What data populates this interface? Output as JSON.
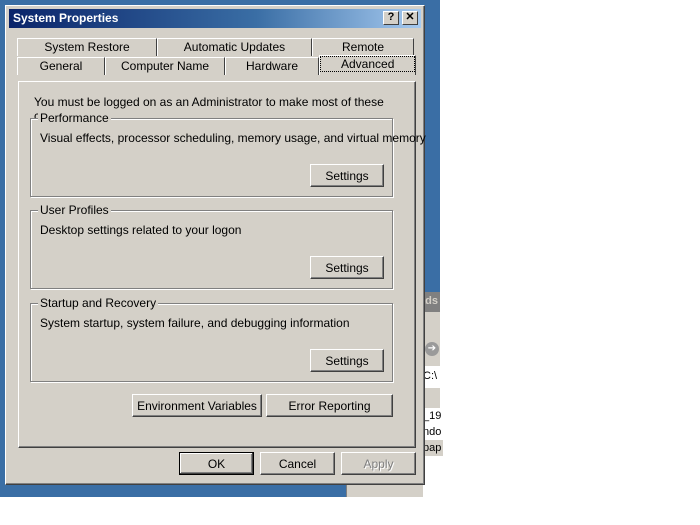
{
  "desktop": {
    "background_window": {
      "title": "ads",
      "address": "C:\\",
      "list_items": [
        "_19",
        "ndo",
        "pap"
      ]
    }
  },
  "dialog": {
    "title": "System Properties",
    "help_label": "?",
    "close_label": "✕",
    "tabs_back": [
      "System Restore",
      "Automatic Updates",
      "Remote"
    ],
    "tabs_front": [
      "General",
      "Computer Name",
      "Hardware",
      "Advanced"
    ],
    "active_tab": "Advanced",
    "notice": "You must be logged on as an Administrator to make most of these changes.",
    "groups": [
      {
        "label": "Performance",
        "description": "Visual effects, processor scheduling, memory usage, and virtual memory",
        "button": "Settings"
      },
      {
        "label": "User Profiles",
        "description": "Desktop settings related to your logon",
        "button": "Settings"
      },
      {
        "label": "Startup and Recovery",
        "description": "System startup, system failure, and debugging information",
        "button": "Settings"
      }
    ],
    "env_button": "Environment Variables",
    "error_button": "Error Reporting",
    "footer": {
      "ok": "OK",
      "cancel": "Cancel",
      "apply": "Apply"
    },
    "colors": {
      "face": "#d4d0c8",
      "title_start": "#0a246a",
      "title_end": "#a6caf0",
      "desktop": "#3a6ea5"
    }
  }
}
